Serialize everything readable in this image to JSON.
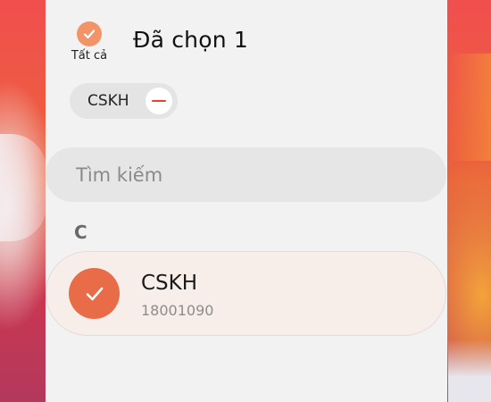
{
  "header": {
    "select_all_label": "Tất cả",
    "selected_count_text": "Đã chọn 1"
  },
  "chips": [
    {
      "label": "CSKH"
    }
  ],
  "search": {
    "placeholder": "Tìm kiếm",
    "value": ""
  },
  "contacts": {
    "section_letter": "C",
    "items": [
      {
        "name": "CSKH",
        "phone": "18001090",
        "selected": true
      }
    ]
  },
  "icons": {
    "select_all": "check-icon",
    "chip_remove": "minus-icon",
    "contact_selected": "check-icon"
  },
  "colors": {
    "accent": "#f29468",
    "avatar": "#e86c48",
    "remove": "#e4412f",
    "sheet": "#f2f2f2",
    "selected_row": "#f8eee9"
  }
}
